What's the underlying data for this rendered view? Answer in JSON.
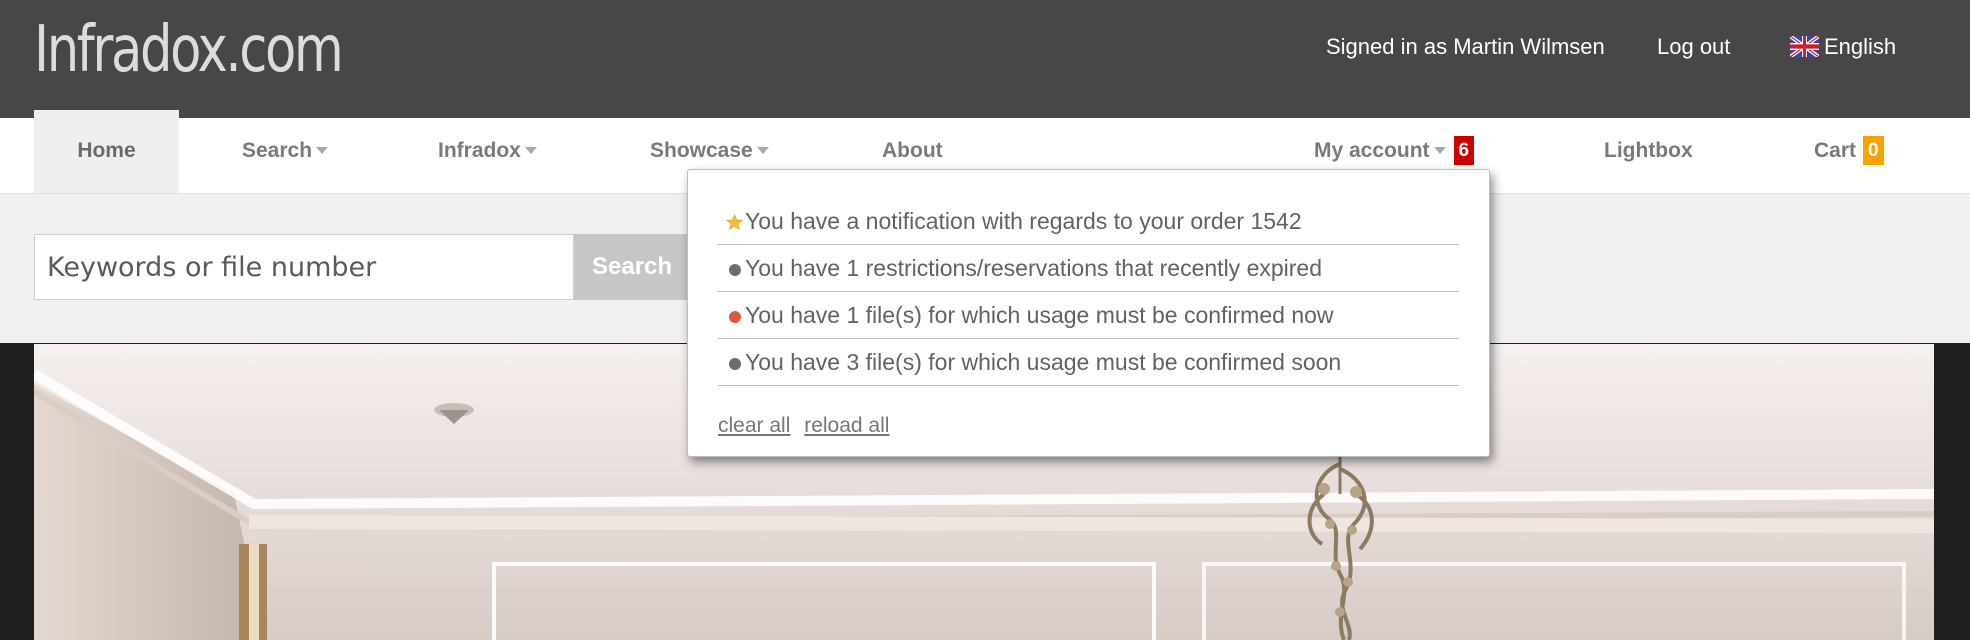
{
  "header": {
    "logo": "Infradox.com",
    "signed_in": "Signed in as Martin Wilmsen",
    "logout": "Log out",
    "language": "English",
    "language_icon": "uk-flag-icon"
  },
  "nav": {
    "home": "Home",
    "search": "Search",
    "infradox": "Infradox",
    "showcase": "Showcase",
    "about": "About",
    "my_account": "My account",
    "my_account_badge": "6",
    "lightbox": "Lightbox",
    "cart": "Cart",
    "cart_badge": "0",
    "colors": {
      "account_badge": "#cc0000",
      "cart_badge": "#f5a300"
    }
  },
  "search": {
    "placeholder": "Keywords or file number",
    "button": "Search"
  },
  "notifications": {
    "items": [
      {
        "text": "You have a notification with regards to your order 1542",
        "icon": "star-icon",
        "color": "#f2c037"
      },
      {
        "text": "You have 1 restrictions/reservations that recently expired",
        "icon": "gray-dot-icon",
        "color": "#6d6d6d"
      },
      {
        "text": "You have 1 file(s) for which usage must be confirmed now",
        "icon": "red-dot-icon",
        "color": "#e2553b"
      },
      {
        "text": "You have 3 file(s) for which usage must be confirmed soon",
        "icon": "gray-dot-icon",
        "color": "#6d6d6d"
      }
    ],
    "clear_all": "clear all",
    "reload_all": "reload all"
  }
}
